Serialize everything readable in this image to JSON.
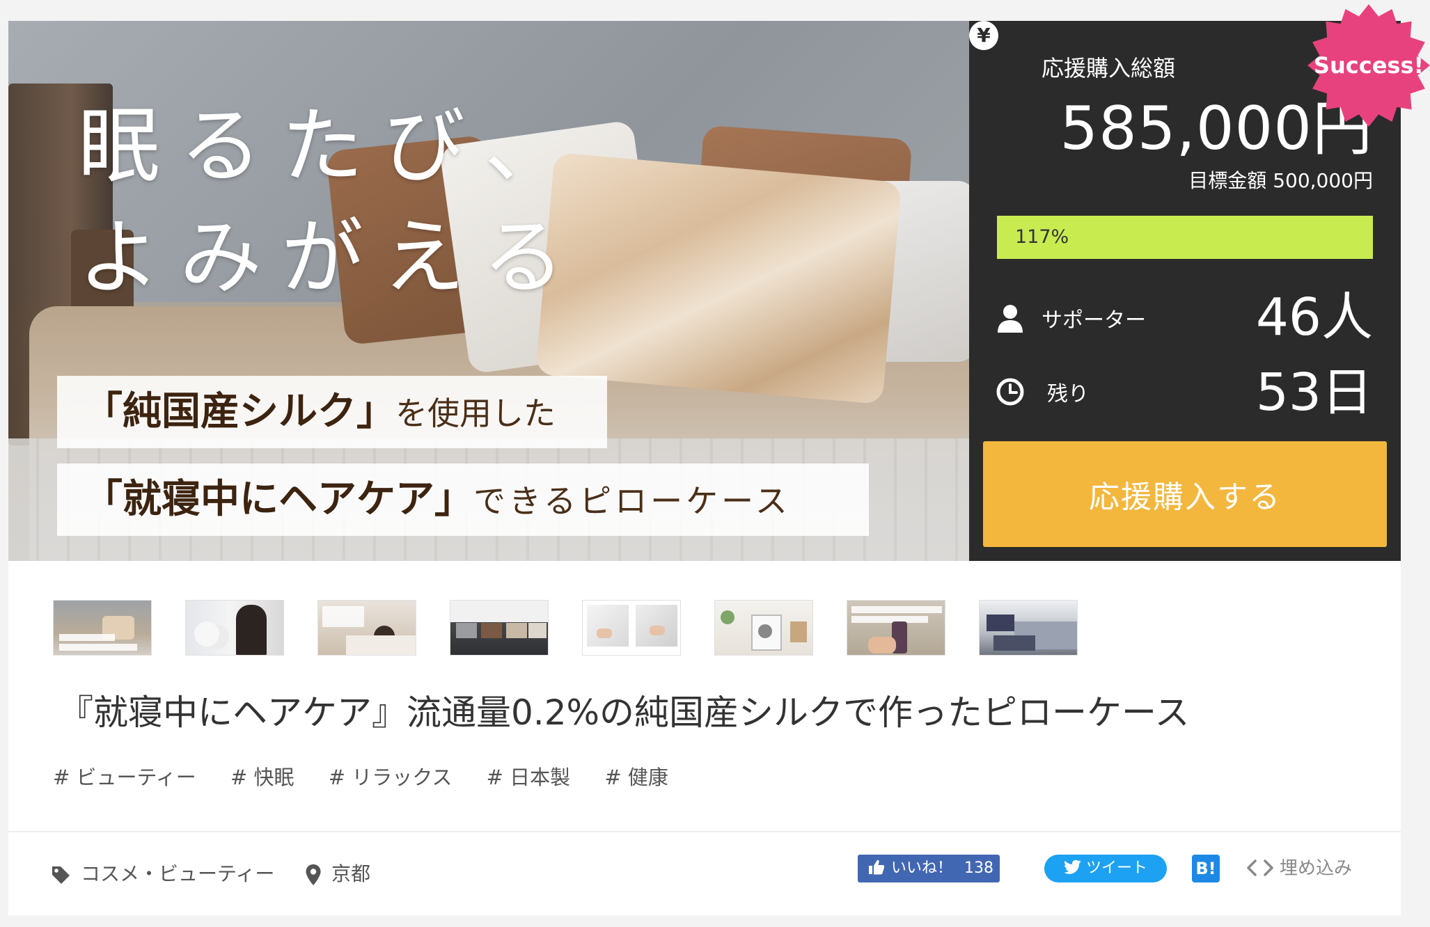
{
  "hero": {
    "title_line1": "眠るたび、",
    "title_line2": "よみがえる",
    "band1_strong": "「純国産シルク」",
    "band1_rest": "を使用した",
    "band2_strong": "「就寝中にヘアケア」",
    "band2_rest": "できるピローケース"
  },
  "stats": {
    "currency_icon": "¥",
    "total_label": "応援購入総額",
    "total_amount": "585,000円",
    "goal": "目標金額 500,000円",
    "progress_fraction": 1.17,
    "progress_text": "117%",
    "progress_color": "#c8ec50",
    "supporter_label": "サポーター",
    "supporter_value": "46人",
    "remain_label": "残り",
    "remain_value": "53日",
    "buy_label": "応援購入する",
    "success_badge": "Success!",
    "buy_color": "#f3b73e",
    "badge_color": "#e8427e"
  },
  "thumbnails": [
    {
      "name": "thumb-1"
    },
    {
      "name": "thumb-2"
    },
    {
      "name": "thumb-3"
    },
    {
      "name": "thumb-4"
    },
    {
      "name": "thumb-5"
    },
    {
      "name": "thumb-6"
    },
    {
      "name": "thumb-7"
    },
    {
      "name": "thumb-8"
    }
  ],
  "project": {
    "title": "『就寝中にヘアケア』流通量0.2%の純国産シルクで作ったピローケース",
    "tags": [
      "# ビューティー",
      "# 快眠",
      "# リラックス",
      "# 日本製",
      "# 健康"
    ]
  },
  "meta": {
    "category": "コスメ・ビューティー",
    "location": "京都"
  },
  "social": {
    "like_label": "いいね！",
    "like_count": "138",
    "tweet_label": "ツイート",
    "hatena_label": "B!",
    "embed_label": "埋め込み"
  }
}
